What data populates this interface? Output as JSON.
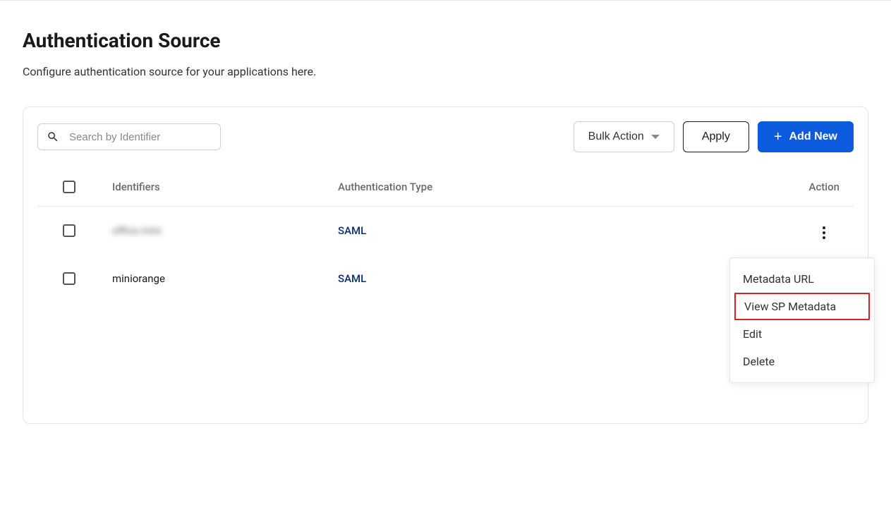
{
  "header": {
    "title": "Authentication Source",
    "subtitle": "Configure authentication source for your applications here."
  },
  "toolbar": {
    "search_placeholder": "Search by Identifier",
    "bulk_action_label": "Bulk Action",
    "apply_label": "Apply",
    "add_new_label": "Add New"
  },
  "table": {
    "columns": {
      "identifiers": "Identifiers",
      "auth_type": "Authentication Type",
      "action": "Action"
    },
    "rows": [
      {
        "identifier": "office mini",
        "auth_type": "SAML",
        "blurred": true
      },
      {
        "identifier": "miniorange",
        "auth_type": "SAML",
        "blurred": false
      }
    ]
  },
  "action_menu": {
    "items": [
      {
        "label": "Metadata URL",
        "highlighted": false
      },
      {
        "label": "View SP Metadata",
        "highlighted": true
      },
      {
        "label": "Edit",
        "highlighted": false
      },
      {
        "label": "Delete",
        "highlighted": false
      }
    ]
  }
}
